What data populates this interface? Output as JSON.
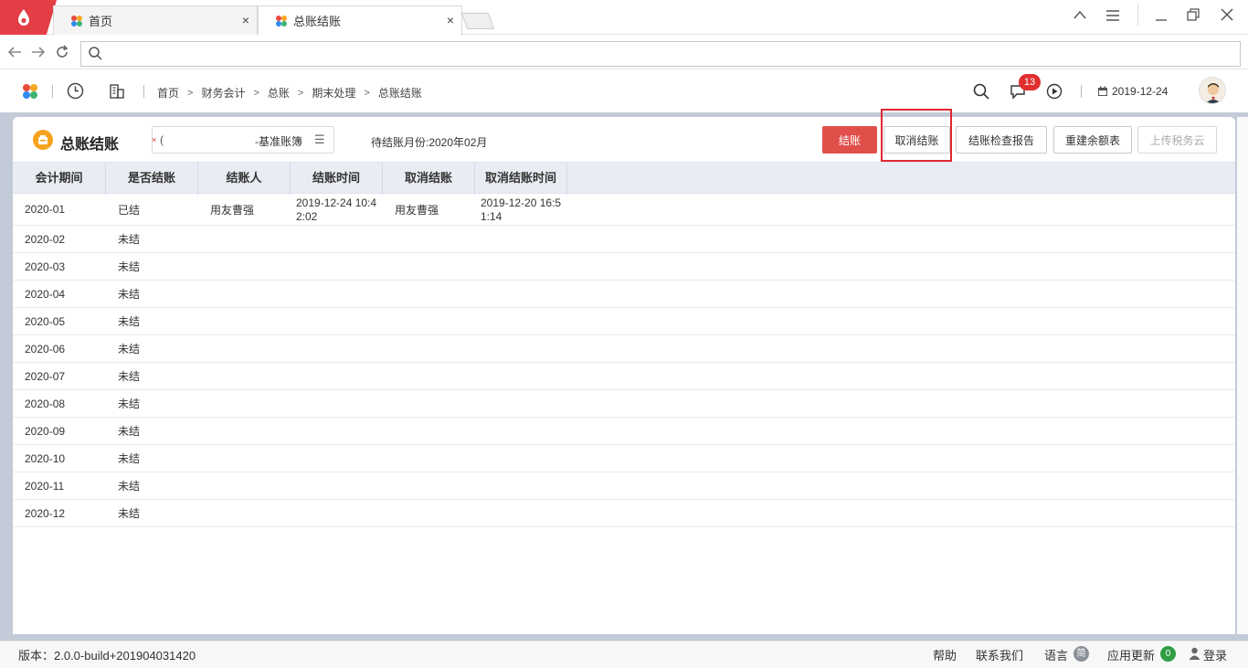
{
  "browser": {
    "tabs": [
      {
        "label": "首页"
      },
      {
        "label": "总账结账"
      }
    ],
    "close_glyph": "×"
  },
  "header": {
    "breadcrumbs": [
      "首页",
      "财务会计",
      "总账",
      "期末处理",
      "总账结账"
    ],
    "notification_count": "13",
    "date": "2019-12-24"
  },
  "page": {
    "title": "总账结账",
    "book_prefix": "(",
    "book_name": "-基准账簿",
    "pending_month": "待结账月份:2020年02月",
    "buttons": {
      "close": "结账",
      "cancel_close": "取消结账",
      "check_report": "结账检查报告",
      "rebuild": "重建余额表",
      "upload": "上传税务云"
    }
  },
  "table": {
    "columns": [
      "会计期间",
      "是否结账",
      "结账人",
      "结账时间",
      "取消结账",
      "取消结账时间"
    ],
    "rows": [
      {
        "period": "2020-01",
        "closed": "已结",
        "closer": "用友曹强",
        "close_time": "2019-12-24 10:42:02",
        "canceller": "用友曹强",
        "cancel_time": "2019-12-20 16:51:14"
      },
      {
        "period": "2020-02",
        "closed": "未结",
        "closer": "",
        "close_time": "",
        "canceller": "",
        "cancel_time": ""
      },
      {
        "period": "2020-03",
        "closed": "未结",
        "closer": "",
        "close_time": "",
        "canceller": "",
        "cancel_time": ""
      },
      {
        "period": "2020-04",
        "closed": "未结",
        "closer": "",
        "close_time": "",
        "canceller": "",
        "cancel_time": ""
      },
      {
        "period": "2020-05",
        "closed": "未结",
        "closer": "",
        "close_time": "",
        "canceller": "",
        "cancel_time": ""
      },
      {
        "period": "2020-06",
        "closed": "未结",
        "closer": "",
        "close_time": "",
        "canceller": "",
        "cancel_time": ""
      },
      {
        "period": "2020-07",
        "closed": "未结",
        "closer": "",
        "close_time": "",
        "canceller": "",
        "cancel_time": ""
      },
      {
        "period": "2020-08",
        "closed": "未结",
        "closer": "",
        "close_time": "",
        "canceller": "",
        "cancel_time": ""
      },
      {
        "period": "2020-09",
        "closed": "未结",
        "closer": "",
        "close_time": "",
        "canceller": "",
        "cancel_time": ""
      },
      {
        "period": "2020-10",
        "closed": "未结",
        "closer": "",
        "close_time": "",
        "canceller": "",
        "cancel_time": ""
      },
      {
        "period": "2020-11",
        "closed": "未结",
        "closer": "",
        "close_time": "",
        "canceller": "",
        "cancel_time": ""
      },
      {
        "period": "2020-12",
        "closed": "未结",
        "closer": "",
        "close_time": "",
        "canceller": "",
        "cancel_time": ""
      }
    ]
  },
  "status": {
    "version": "版本：2.0.0-build+201904031420",
    "help": "帮助",
    "contact": "联系我们",
    "language": "语言",
    "language_value": "简",
    "updates": "应用更新",
    "update_count": "0",
    "login": "登录"
  },
  "colors": {
    "accent_red": "#e14f4b",
    "highlight": "#e3262f",
    "header_bg": "#e9ecf3",
    "backdrop": "#c3cbd8"
  }
}
